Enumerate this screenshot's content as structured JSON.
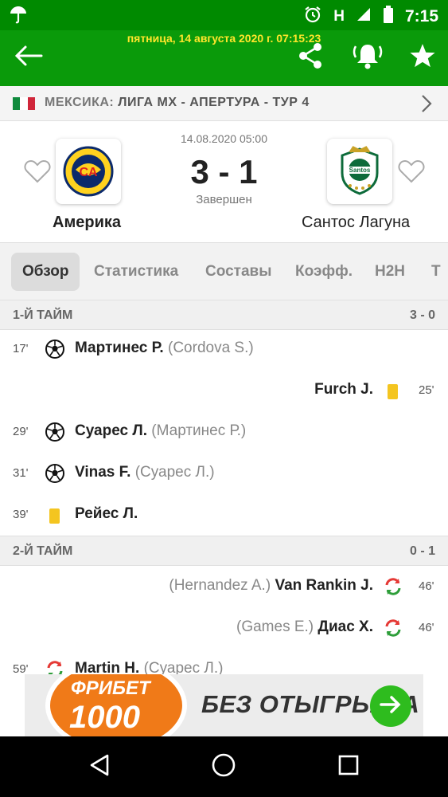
{
  "status_bar": {
    "time": "7:15",
    "network": "H"
  },
  "app_bar": {
    "datetime": "пятница, 14 августа 2020 г. 07:15:23"
  },
  "league": {
    "country": "МЕКСИКА:",
    "name": "ЛИГА МХ - АПЕРТУРА - ТУР 4"
  },
  "match": {
    "date": "14.08.2020 05:00",
    "score": "3 - 1",
    "status": "Завершен",
    "home": "Америка",
    "away": "Сантос Лагуна",
    "home_logo_text": "CA",
    "away_logo_text": "Santos"
  },
  "tabs": [
    "Обзор",
    "Статистика",
    "Составы",
    "Коэфф.",
    "H2H",
    "Т"
  ],
  "sections": [
    {
      "title": "1-Й ТАЙМ",
      "score": "3 - 0"
    },
    {
      "title": "2-Й ТАЙМ",
      "score": "0 - 1"
    }
  ],
  "events_first_half": [
    {
      "minute": "17'",
      "player": "Мартинес Р.",
      "assist": "(Cordova S.)"
    },
    {
      "minute": "25'",
      "player": "Furch J."
    },
    {
      "minute": "29'",
      "player": "Суарес Л.",
      "assist": "(Мартинес Р.)"
    },
    {
      "minute": "31'",
      "player": "Vinas F.",
      "assist": "(Суарес Л.)"
    },
    {
      "minute": "39'",
      "player": "Рейес Л."
    }
  ],
  "events_second_half": [
    {
      "minute": "46'",
      "player": "Van Rankin J.",
      "assist": "(Hernandez A.)"
    },
    {
      "minute": "46'",
      "player": "Диас Х.",
      "assist": "(Games E.)"
    },
    {
      "minute": "59'",
      "player": "Martin H.",
      "assist": "(Суарес Л.)"
    }
  ],
  "ad": {
    "line1": "ФРИБЕТ",
    "line2": "1000",
    "text": "БЕЗ ОТЫГРЫША"
  },
  "colors": {
    "brand_green": "#0a9a0a",
    "yellow_card": "#f4c520",
    "sub_red": "#e53935",
    "sub_green": "#2e9e3a"
  }
}
